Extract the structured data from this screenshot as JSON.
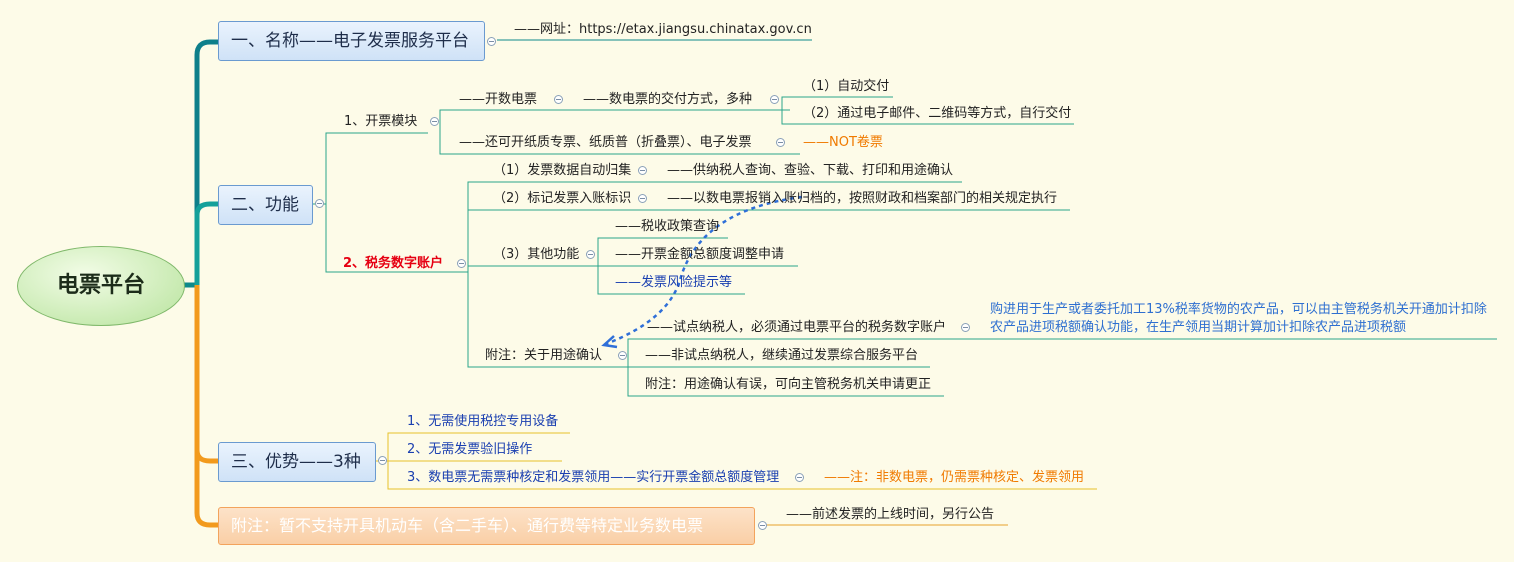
{
  "root": "电票平台",
  "b1": {
    "label": "一、名称——电子发票服务平台",
    "url": "——网址：https://etax.jiangsu.chinatax.gov.cn"
  },
  "b2": {
    "label": "二、功能",
    "kp": {
      "label": "1、开票模块",
      "sub1": "——开数电票",
      "sub1_detail": "——数电票的交付方式，多种",
      "deliver1": "（1）自动交付",
      "deliver2": "（2）通过电子邮件、二维码等方式，自行交付",
      "sub2": "——还可开纸质专票、纸质普（折叠票）、电子发票",
      "sub2_note": "——NOT卷票"
    },
    "sw": {
      "label": "2、税务数字账户",
      "f1": "（1）发票数据自动归集",
      "f1_detail": "——供纳税人查询、查验、下载、打印和用途确认",
      "f2": "（2）标记发票入账标识",
      "f2_detail": "——以数电票报销入账归档的，按照财政和档案部门的相关规定执行",
      "f3": "（3）其他功能",
      "f3_a": "——税收政策查询",
      "f3_b": "——开票金额总额度调整申请",
      "f3_c": "——发票风险提示等",
      "note": "附注：关于用途确认",
      "n1": "——试点纳税人，必须通过电票平台的税务数字账户",
      "n1_detail_1": "购进用于生产或者委托加工13%税率货物的农产品，可以由主管税务机关开通加计扣除",
      "n1_detail_2": "农产品进项税额确认功能，在生产领用当期计算加计扣除农产品进项税额",
      "n2": "——非试点纳税人，继续通过发票综合服务平台",
      "n3": "附注：用途确认有误，可向主管税务机关申请更正"
    }
  },
  "b3": {
    "label": "三、优势——3种",
    "a1": "1、无需使用税控专用设备",
    "a2": "2、无需发票验旧操作",
    "a3": "3、数电票无需票种核定和发票领用——实行开票金额总额度管理",
    "a3_note": "——注：非数电票，仍需票种核定、发票领用"
  },
  "b4": {
    "label": "附注：暂不支持开具机动车（含二手车）、通行费等特定业务数电票",
    "note": "——前述发票的上线时间，另行公告"
  },
  "colors": {
    "teal": "#0e8a8a",
    "orange": "#f29a1d",
    "green_line": "#2aa58a",
    "yellow_line": "#e6c22a",
    "dash": "#2f6fd8"
  }
}
